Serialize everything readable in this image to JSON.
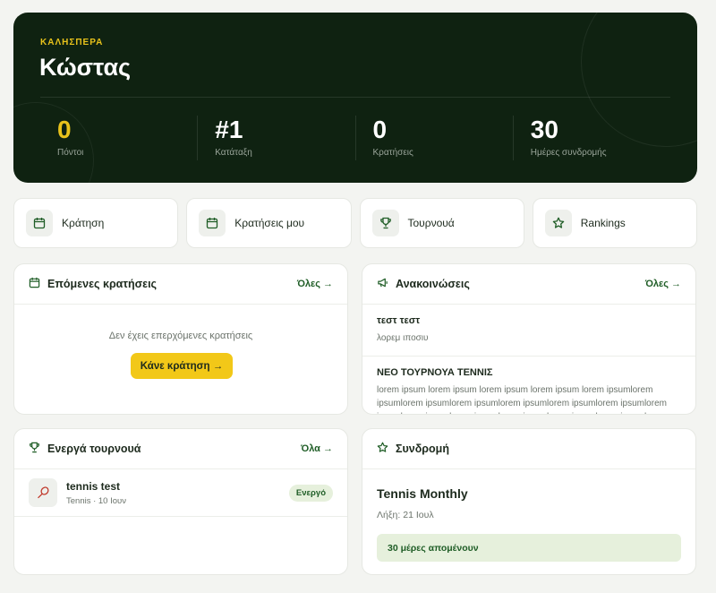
{
  "hero": {
    "greeting": "ΚΑΛΗΣΠΕΡΑ",
    "name": "Κώστας",
    "stats": [
      {
        "value": "0",
        "label": "Πόντοι"
      },
      {
        "value": "#1",
        "label": "Κατάταξη"
      },
      {
        "value": "0",
        "label": "Κρατήσεις"
      },
      {
        "value": "30",
        "label": "Ημέρες συνδρομής"
      }
    ]
  },
  "actions": [
    {
      "label": "Κράτηση",
      "icon": "calendar-icon"
    },
    {
      "label": "Κρατήσεις μου",
      "icon": "calendar-icon"
    },
    {
      "label": "Τουρνουά",
      "icon": "trophy-icon"
    },
    {
      "label": "Rankings",
      "icon": "star-icon"
    }
  ],
  "bookings": {
    "title": "Επόμενες κρατήσεις",
    "link": "Όλες →",
    "empty": "Δεν έχεις επερχόμενες κρατήσεις",
    "cta": "Κάνε κράτηση →"
  },
  "announcements": {
    "title": "Ανακοινώσεις",
    "link": "Όλες →",
    "items": [
      {
        "title": "τεστ τεστ",
        "body": "λορεμ ιποσιυ"
      },
      {
        "title": "ΝΕΟ ΤΟΥΡΝΟΥΑ ΤΕΝΝΙΣ",
        "body": "lorem ipsum lorem ipsum lorem ipsum lorem ipsum lorem ipsumlorem ipsumlorem ipsumlorem ipsumlorem ipsumlorem ipsumlorem ipsumlorem ipsumlorem ipsumlorem ipsumlorem ipsumlorem ipsumlorem ipsumlorem ipsumlorem ipsumlorem ipsum"
      }
    ]
  },
  "tournaments": {
    "title": "Ενεργά τουρνουά",
    "link": "Όλα →",
    "items": [
      {
        "name": "tennis test",
        "meta": "Tennis · 10 Ιουν",
        "badge": "Ενεργό"
      }
    ]
  },
  "subscription": {
    "title": "Συνδρομή",
    "plan": "Tennis Monthly",
    "expiry": "Λήξη: 21 Ιουλ",
    "remaining": "30 μέρες απομένουν"
  },
  "colors": {
    "hero_bg": "#0f2211",
    "accent_gold": "#e8c21b",
    "cta_yellow": "#f2c818",
    "brand_green": "#1f5d26",
    "badge_bg": "#e6f0dc"
  }
}
